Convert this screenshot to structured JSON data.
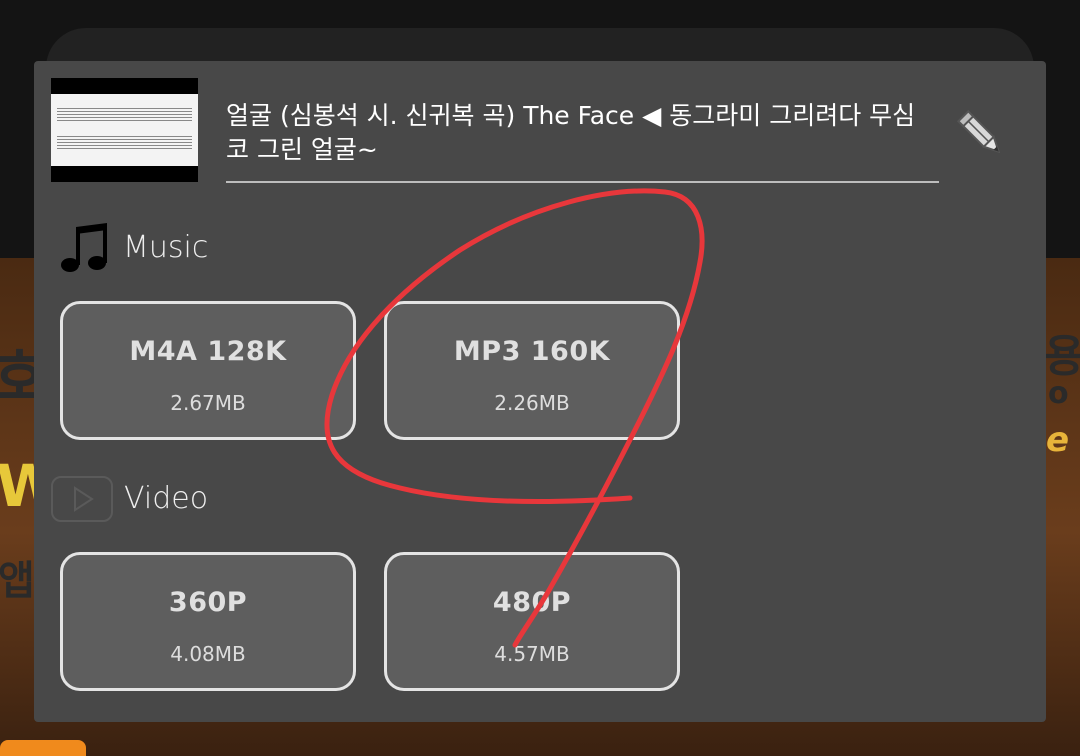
{
  "background": {
    "fragments": [
      "호",
      "W",
      "앱",
      "용",
      "o",
      "e"
    ]
  },
  "dialog": {
    "title": "얼굴 (심봉석 시. 신귀복 곡) The Face ◀ 동그라미 그리려다 무심코 그린 얼굴~",
    "edit_icon": "pencil-icon",
    "music": {
      "label": "Music",
      "icon": "music-note-icon",
      "options": [
        {
          "format": "M4A 128K",
          "size": "2.67MB"
        },
        {
          "format": "MP3 160K",
          "size": "2.26MB"
        }
      ]
    },
    "video": {
      "label": "Video",
      "icon": "play-icon",
      "options": [
        {
          "format": "360P",
          "size": "4.08MB"
        },
        {
          "format": "480P",
          "size": "4.57MB"
        }
      ]
    }
  },
  "colors": {
    "dialog_bg": "#484848",
    "button_bg": "#5e5e5e",
    "button_border": "#e4e4e4",
    "annotation": "#e8373b"
  }
}
